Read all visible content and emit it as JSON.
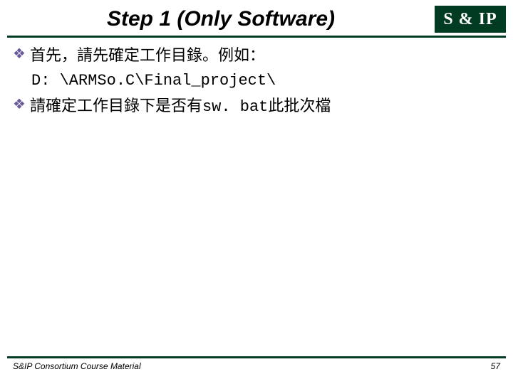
{
  "title": "Step 1 (Only Software)",
  "logo": "S & IP",
  "bullets": {
    "b1_text": "首先，請先確定工作目錄。例如：",
    "path": "D: \\ARMSo.C\\Final_project\\",
    "b2_prefix": "請確定工作目錄下是否有",
    "b2_code": "sw. bat",
    "b2_suffix": "此批次檔"
  },
  "footer": {
    "left": "S&IP Consortium Course Material",
    "right": "57"
  }
}
